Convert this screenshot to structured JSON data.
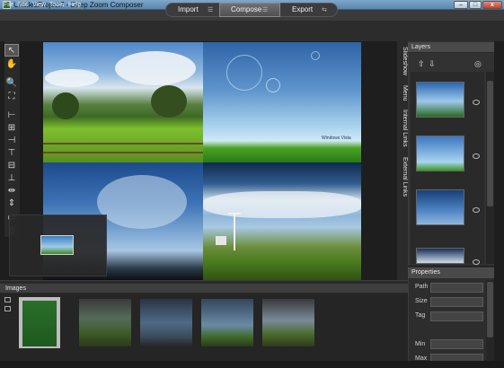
{
  "window": {
    "title": "UntitledProject7 - Deep Zoom Composer",
    "minimize_glyph": "–",
    "maximize_glyph": "□",
    "close_glyph": "x"
  },
  "menu": {
    "items": [
      {
        "label": "File"
      },
      {
        "label": "Edit"
      },
      {
        "label": "View"
      },
      {
        "label": "Tools"
      },
      {
        "label": "Help"
      }
    ]
  },
  "modes": {
    "items": [
      {
        "label": "Import",
        "glyph": "☰"
      },
      {
        "label": "Compose",
        "glyph": "☰"
      },
      {
        "label": "Export",
        "glyph": "⇆"
      }
    ],
    "active": "Compose"
  },
  "tools": [
    {
      "icon": "pointer-icon",
      "glyph": "↖"
    },
    {
      "icon": "hand-icon",
      "glyph": "✋"
    },
    {
      "icon": "zoom-icon",
      "glyph": "🔍"
    },
    {
      "icon": "fit-icon",
      "glyph": "⛶"
    },
    {
      "icon": "align-left-icon",
      "glyph": "⊢"
    },
    {
      "icon": "align-center-icon",
      "glyph": "⊞"
    },
    {
      "icon": "align-right-icon",
      "glyph": "⊣"
    },
    {
      "icon": "align-top-icon",
      "glyph": "⊤"
    },
    {
      "icon": "align-middle-icon",
      "glyph": "⊟"
    },
    {
      "icon": "align-bottom-icon",
      "glyph": "⊥"
    },
    {
      "icon": "distribute-horizontal-icon",
      "glyph": "⇹"
    },
    {
      "icon": "distribute-vertical-icon",
      "glyph": "⇕"
    },
    {
      "icon": "group-icon",
      "glyph": "▭"
    },
    {
      "icon": "ungroup-icon",
      "glyph": "▯"
    }
  ],
  "canvas": {
    "photos": [
      {
        "name": "photo-landscape"
      },
      {
        "name": "photo-bubbles"
      },
      {
        "name": "photo-sky"
      },
      {
        "name": "photo-turbines"
      }
    ],
    "bubbles_watermark": "Windows Vista"
  },
  "side_tabs": [
    {
      "label": "Slideshow"
    },
    {
      "label": "Menu"
    },
    {
      "label": "Internal Links"
    },
    {
      "label": "External Links"
    }
  ],
  "layers": {
    "title": "Layers",
    "move_up_glyph": "⇧",
    "move_down_glyph": "⇩",
    "eye_glyph": "◎",
    "items": [
      {
        "thumb": "layer-thumb-sky-city"
      },
      {
        "thumb": "layer-thumb-bubbles"
      },
      {
        "thumb": "layer-thumb-cloud-sky"
      },
      {
        "thumb": "layer-thumb-turbines"
      }
    ]
  },
  "properties": {
    "title": "Properties",
    "fields": [
      {
        "label": "Path",
        "value": ""
      },
      {
        "label": "Size",
        "value": ""
      },
      {
        "label": "Tag",
        "value": ""
      },
      {
        "label": "Min",
        "value": ""
      },
      {
        "label": "Max",
        "value": ""
      }
    ]
  },
  "images": {
    "title": "Images",
    "thumbnails": [
      {
        "name": "image-thumb-1"
      },
      {
        "name": "image-thumb-2"
      },
      {
        "name": "image-thumb-3"
      },
      {
        "name": "image-thumb-4"
      },
      {
        "name": "image-thumb-5"
      }
    ]
  },
  "colors": {
    "background": "#1e1e1e",
    "panel": "#323232",
    "accent": "#5a87b0"
  }
}
